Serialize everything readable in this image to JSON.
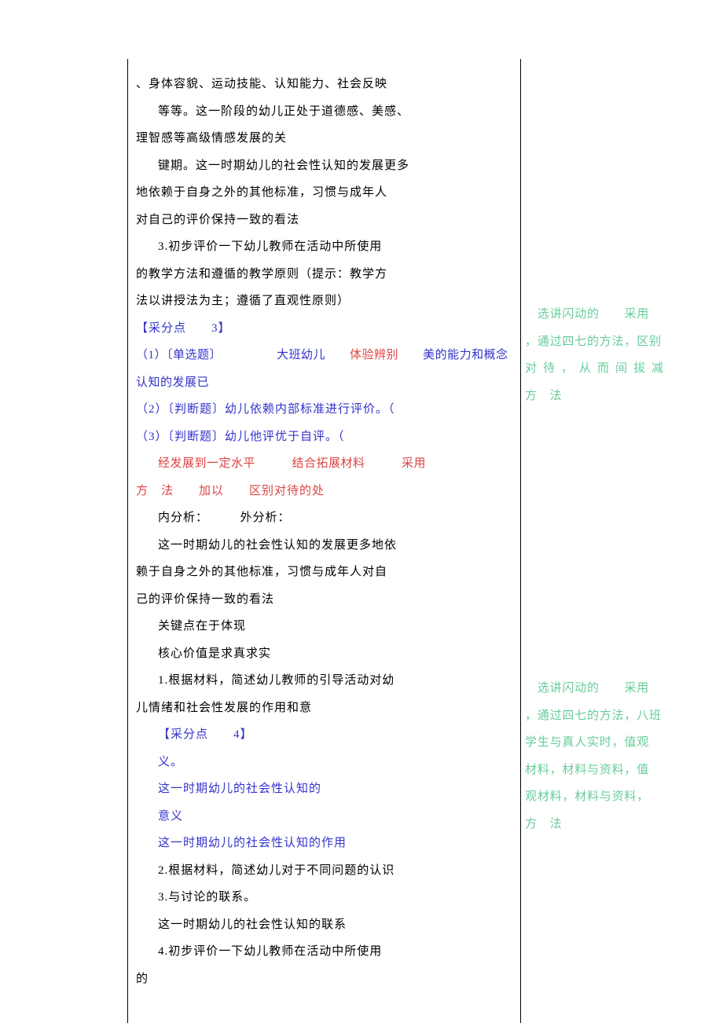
{
  "main": {
    "p1": "、身体容貌、运动技能、认知能力、社会反映",
    "p2": "等等。这一阶段的幼儿正处于道德感、美感、",
    "p3": "理智感等高级情感发展的关",
    "p4": "键期。这一时期幼儿的社会性认知的发展更多",
    "p5": "地依赖于自身之外的其他标准，习惯与成年人",
    "p6": "对自己的评价保持一致的看法",
    "p7": "3.初步评价一下幼儿教师在活动中所使用",
    "p8": "的教学方法和遵循的教学原则（提示：教学方",
    "p9": "法以讲授法为主；遵循了直观性原则）",
    "sec3": "【采分点　　3】",
    "r1_a": "（1）〔单选题〕　　　　　大班幼儿",
    "r1_b": "体验辨别",
    "r1_c": "美的能力和概念认知的发展已",
    "r2": "（2）〔判断题〕幼儿依赖内部标准进行评价。（",
    "r3": "（3）〔判断题〕幼儿他评优于自评。（",
    "r4_a": "经发展到一定水平　　　结合拓展材料",
    "r4_b": "采用",
    "r5_a": "方　法　　加以",
    "r5_b": "区别对待的处",
    "p10": "内分析：　　　外分析：",
    "p11": "这一时期幼儿的社会性认知的发展更多地依",
    "p12": "赖于自身之外的其他标准，习惯与成年人对自",
    "p13": "己的评价保持一致的看法",
    "p14": "关键点在于体现",
    "p15": "核心价值是求真求实",
    "p16": "1.根据材料，简述幼儿教师的引导活动对幼",
    "p17": "儿情绪和社会性发展的作用和意",
    "sec4": "【采分点　　4】",
    "p18": "义。",
    "p19": "这一时期幼儿的社会性认知的",
    "p20": "意义",
    "p21": "这一时期幼儿的社会性认知的作用",
    "p22": "2.根据材料，简述幼儿对于不同问题的认识",
    "p23": "3.与讨论的联系。",
    "p24": "这一时期幼儿的社会性认知的联系",
    "p25": "4.初步评价一下幼儿教师在活动中所使用",
    "p26": "的"
  },
  "side": {
    "s1_a": "选讲闪动的",
    "s1_b": "采用",
    "s1_c": "，通过四七的方法，区别",
    "s1_d": "对待，从而间拔减",
    "s1_e": "方　法",
    "s2_a": "选讲闪动的",
    "s2_b": "采用",
    "s2_c": "，通过四七的方法，八班",
    "s2_d": "学生与真人实时，值观",
    "s2_e": "材料，材料与资料，值",
    "s2_f": "观材料，材料与资料，",
    "s2_g": "方　法"
  }
}
